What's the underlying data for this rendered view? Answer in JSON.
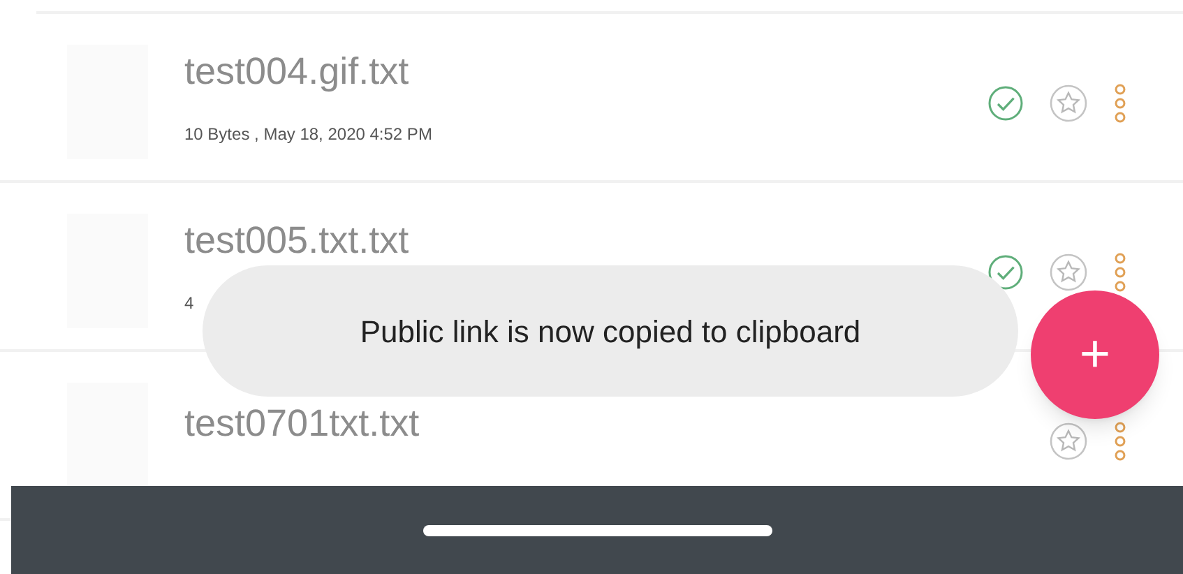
{
  "files": [
    {
      "name": "test004.gif.txt",
      "meta": "10 Bytes , May 18, 2020 4:52 PM",
      "synced": true
    },
    {
      "name": "test005.txt.txt",
      "meta": "4",
      "synced": true
    },
    {
      "name": "test0701txt.txt",
      "synced": false
    }
  ],
  "toast": {
    "message": "Public link is now copied to clipboard"
  },
  "fab": {
    "label": "+"
  }
}
